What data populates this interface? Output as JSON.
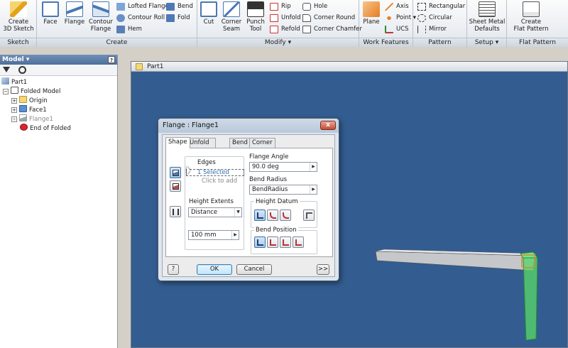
{
  "ribbon": {
    "sketch": {
      "create_3d_sketch": "Create\n3D Sketch",
      "panel_title": "Sketch"
    },
    "create": {
      "face": "Face",
      "flange": "Flange",
      "contour_flange": "Contour\nFlange",
      "lofted_flange": "Lofted Flange",
      "contour_roll": "Contour Roll",
      "hem": "Hem",
      "bend": "Bend",
      "fold": "Fold",
      "panel_title": "Create"
    },
    "modify": {
      "cut": "Cut",
      "corner_seam": "Corner\nSeam",
      "punch_tool": "Punch\nTool",
      "rip": "Rip",
      "unfold": "Unfold",
      "refold": "Refold",
      "hole": "Hole",
      "corner_round": "Corner Round",
      "corner_chamfer": "Corner Chamfer",
      "panel_title": "Modify ▾"
    },
    "work_features": {
      "plane": "Plane",
      "axis": "Axis",
      "point": "Point ▾",
      "ucs": "UCS",
      "panel_title": "Work Features"
    },
    "pattern": {
      "rectangular": "Rectangular",
      "circular": "Circular",
      "mirror": "Mirror",
      "panel_title": "Pattern"
    },
    "setup": {
      "sheet_metal_defaults": "Sheet Metal\nDefaults",
      "panel_title": "Setup ▾"
    },
    "flat_pattern": {
      "create_flat_pattern": "Create\nFlat Pattern",
      "panel_title": "Flat Pattern"
    }
  },
  "browser": {
    "title": "Model ▾",
    "help": "?",
    "tree": {
      "part": "Part1",
      "folded_model": "Folded Model",
      "origin": "Origin",
      "face1": "Face1",
      "flange1": "Flange1",
      "end_of_folded": "End of Folded"
    }
  },
  "graphics": {
    "title": "Part1"
  },
  "dialog": {
    "title": "Flange : Flange1",
    "close": "x",
    "tabs": [
      "Shape",
      "Unfold Options",
      "Bend",
      "Corner"
    ],
    "edges_label": "Edges",
    "edges_selected": "1 Selected",
    "edges_add": "Click to add",
    "flange_angle_label": "Flange Angle",
    "flange_angle_value": "90.0 deg",
    "bend_radius_label": "Bend Radius",
    "bend_radius_value": "BendRadius",
    "height_extents_label": "Height Extents",
    "height_extents_value": "Distance",
    "height_value": "100 mm",
    "height_datum_label": "Height Datum",
    "bend_position_label": "Bend Position",
    "ok": "OK",
    "cancel": "Cancel",
    "more": ">>",
    "help": "?"
  },
  "colors": {
    "viewport": "#335d91",
    "selection_green": "#4fd36a",
    "panel_gray": "#b8b8b8"
  }
}
